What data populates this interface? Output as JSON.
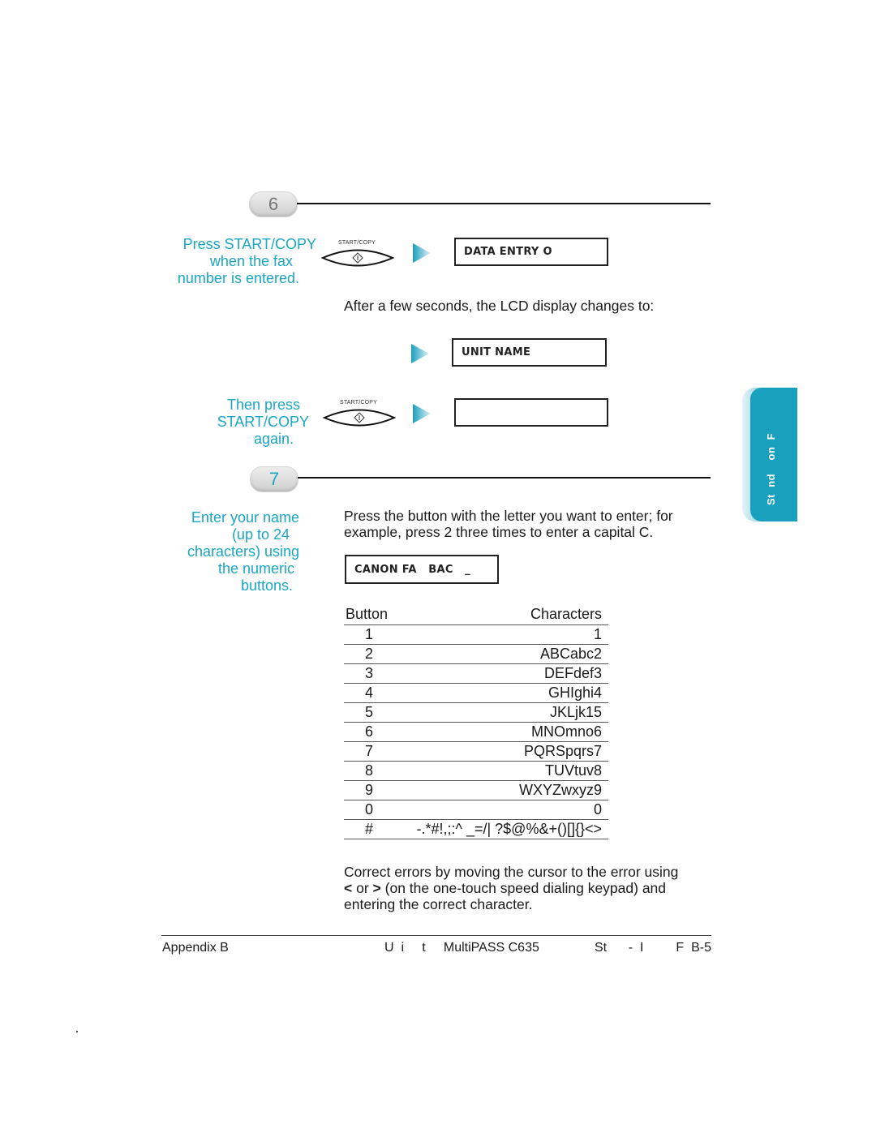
{
  "steps": [
    {
      "number": "6",
      "instruction_lines": [
        "Press START/COPY",
        "when the fax",
        "number is entered."
      ],
      "button_label": "START/COPY",
      "lcd_1": "DATA ENTRY O",
      "after_text": "After a few seconds, the LCD display changes to:",
      "lcd_2": "UNIT NAME",
      "instruction2_lines": [
        "Then press",
        "START/COPY",
        "again."
      ],
      "button2_label": "START/COPY",
      "lcd_3": ""
    },
    {
      "number": "7",
      "instruction_lines": [
        "Enter your name",
        "(up to 24",
        "characters) using",
        "the numeric",
        "buttons."
      ],
      "body_lines": [
        "Press the button with the letter you want to enter; for",
        "example, press 2 three times to enter a capital C."
      ],
      "lcd": "CANON FA   BAC   _",
      "table": {
        "headers": [
          "Button",
          "Characters"
        ],
        "rows": [
          [
            "1",
            "1"
          ],
          [
            "2",
            "ABCabc2"
          ],
          [
            "3",
            "DEFdef3"
          ],
          [
            "4",
            "GHIghi4"
          ],
          [
            "5",
            "JKLjk15"
          ],
          [
            "6",
            "MNOmno6"
          ],
          [
            "7",
            "PQRSpqrs7"
          ],
          [
            "8",
            "TUVtuv8"
          ],
          [
            "9",
            "WXYZwxyz9"
          ],
          [
            "0",
            "0"
          ],
          [
            "#",
            "-.*#!,;:^ _=/| ?$@%&+()[]{}<>"
          ]
        ]
      },
      "correct_lines": [
        "Correct errors by moving the cursor to the error using",
        "(on the one-touch speed dialing keypad) and",
        "entering the correct character."
      ],
      "correct_keys": {
        "left": "<",
        "or": "or",
        "right": ">"
      }
    }
  ],
  "side_tab": {
    "label": "St  nd    on  F"
  },
  "footer": {
    "left": "Appendix B",
    "middle": "U  i     t     MultiPASS C635",
    "right": "St      -  I         F  B-5"
  },
  "colors": {
    "accent": "#1aa6c4",
    "tab": "#1aa0bf"
  }
}
